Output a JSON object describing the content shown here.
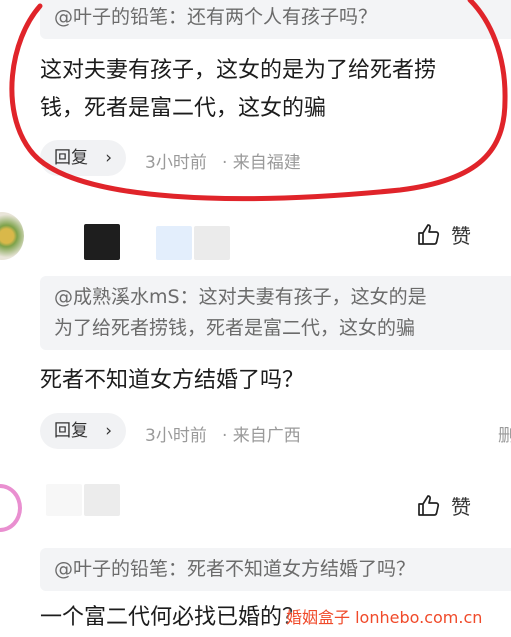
{
  "comments": [
    {
      "quote": "@叶子的铅笔：还有两个人有孩子吗？",
      "text_lines": [
        "这对夫妻有孩子，这女的是为了给死者捞",
        "钱，死者是富二代，这女的骗"
      ],
      "reply_label": "回复",
      "time": "3小时前",
      "location": "· 来自福建"
    },
    {
      "like_label": "赞",
      "quote_lines": [
        "@成熟溪水mS：这对夫妻有孩子，这女的是",
        "为了给死者捞钱，死者是富二代，这女的骗"
      ],
      "text": "死者不知道女方结婚了吗？",
      "reply_label": "回复",
      "time": "3小时前",
      "location": "· 来自广西",
      "edge_char": "删"
    },
    {
      "like_label": "赞",
      "quote": "@叶子的铅笔：死者不知道女方结婚了吗？",
      "text": "一个富二代何必找已婚的？"
    }
  ],
  "watermark": "婚姻盒子 lonhebo.com.cn",
  "colors": {
    "annotation_circle": "#e0242a",
    "watermark": "#f04a2a"
  }
}
